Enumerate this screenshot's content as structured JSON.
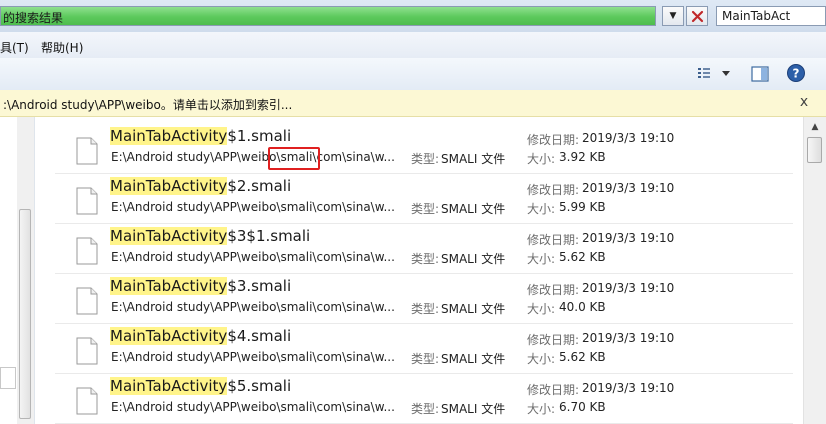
{
  "address_bar": {
    "text": "的搜索结果",
    "dropdown_icon": "chevron-down-icon",
    "close_icon": "red-x-icon"
  },
  "search_box": {
    "value": "MainTabAct"
  },
  "menu": {
    "tools": "具(T)",
    "help": "帮助(H)"
  },
  "infobar": {
    "message": ":\\Android study\\APP\\weibo。请单击以添加到索引...",
    "close": "x"
  },
  "results": [
    {
      "name_highlight": "MainTabActivity",
      "name_rest": "$1.smali",
      "path": "E:\\Android study\\APP\\weibo\\smali\\com\\sina\\w...",
      "type_label": "类型:",
      "type": "SMALI 文件",
      "date_label": "修改日期:",
      "date": "2019/3/3 19:10",
      "size_label": "大小:",
      "size": "3.92 KB"
    },
    {
      "name_highlight": "MainTabActivity",
      "name_rest": "$2.smali",
      "path": "E:\\Android study\\APP\\weibo\\smali\\com\\sina\\w...",
      "type_label": "类型:",
      "type": "SMALI 文件",
      "date_label": "修改日期:",
      "date": "2019/3/3 19:10",
      "size_label": "大小:",
      "size": "5.99 KB"
    },
    {
      "name_highlight": "MainTabActivity",
      "name_rest": "$3$1.smali",
      "path": "E:\\Android study\\APP\\weibo\\smali\\com\\sina\\w...",
      "type_label": "类型:",
      "type": "SMALI 文件",
      "date_label": "修改日期:",
      "date": "2019/3/3 19:10",
      "size_label": "大小:",
      "size": "5.62 KB"
    },
    {
      "name_highlight": "MainTabActivity",
      "name_rest": "$3.smali",
      "path": "E:\\Android study\\APP\\weibo\\smali\\com\\sina\\w...",
      "type_label": "类型:",
      "type": "SMALI 文件",
      "date_label": "修改日期:",
      "date": "2019/3/3 19:10",
      "size_label": "大小:",
      "size": "40.0 KB"
    },
    {
      "name_highlight": "MainTabActivity",
      "name_rest": "$4.smali",
      "path": "E:\\Android study\\APP\\weibo\\smali\\com\\sina\\w...",
      "type_label": "类型:",
      "type": "SMALI 文件",
      "date_label": "修改日期:",
      "date": "2019/3/3 19:10",
      "size_label": "大小:",
      "size": "5.62 KB"
    },
    {
      "name_highlight": "MainTabActivity",
      "name_rest": "$5.smali",
      "path": "E:\\Android study\\APP\\weibo\\smali\\com\\sina\\w...",
      "type_label": "类型:",
      "type": "SMALI 文件",
      "date_label": "修改日期:",
      "date": "2019/3/3 19:10",
      "size_label": "大小:",
      "size": "6.70 KB"
    }
  ],
  "colors": {
    "search_highlight": "#fff48a",
    "annotation_box": "#e02020",
    "infobar_bg": "#fcf8d4"
  },
  "icons": {
    "file": "blank-file-icon",
    "view": "view-options-icon",
    "preview_pane": "preview-pane-icon",
    "help": "help-icon"
  }
}
